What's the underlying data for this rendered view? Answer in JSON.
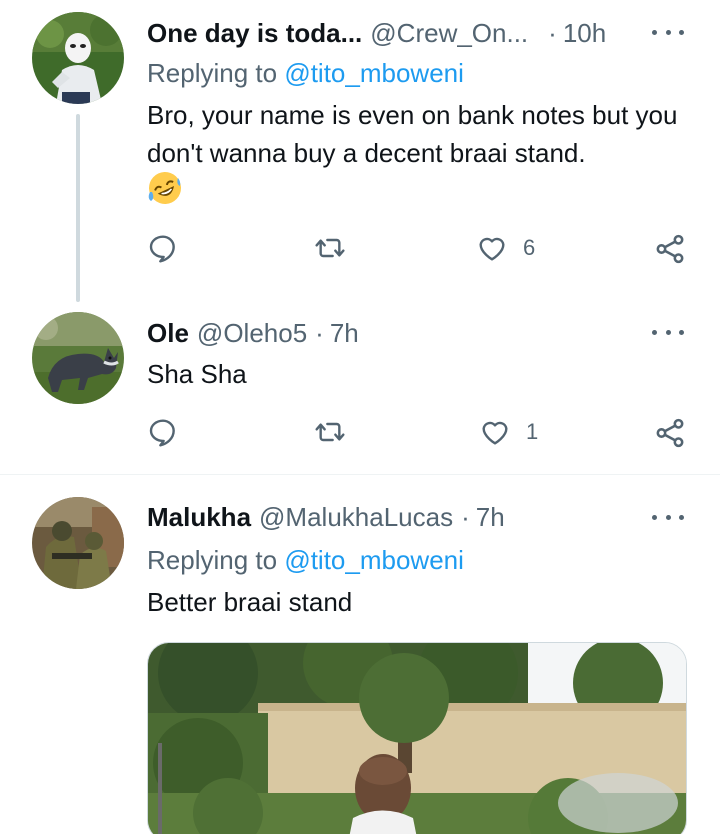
{
  "tweets": [
    {
      "name": "One day is toda...",
      "handle": "@Crew_On...",
      "time": "10h",
      "replying_label": "Replying to",
      "replying_handle": "@tito_mboweni",
      "text": "Bro, your name is even on bank notes but you don't wanna buy a decent braai stand.",
      "emoji": "🤣",
      "likes": "6"
    },
    {
      "name": "Ole",
      "handle": "@Oleho5",
      "time": "7h",
      "text": "Sha Sha",
      "likes": "1"
    },
    {
      "name": "Malukha",
      "handle": "@MalukhaLucas",
      "time": "7h",
      "replying_label": "Replying to",
      "replying_handle": "@tito_mboweni",
      "text": "Better braai stand"
    }
  ],
  "separator": "·",
  "icons": {
    "reply": "reply-icon",
    "retweet": "retweet-icon",
    "like": "heart-icon",
    "share": "share-icon",
    "more": "more-icon"
  },
  "colors": {
    "link": "#1d9bf0",
    "secondary_text": "#536471",
    "primary_text": "#0f1419",
    "thread_line": "#cfd9de"
  }
}
